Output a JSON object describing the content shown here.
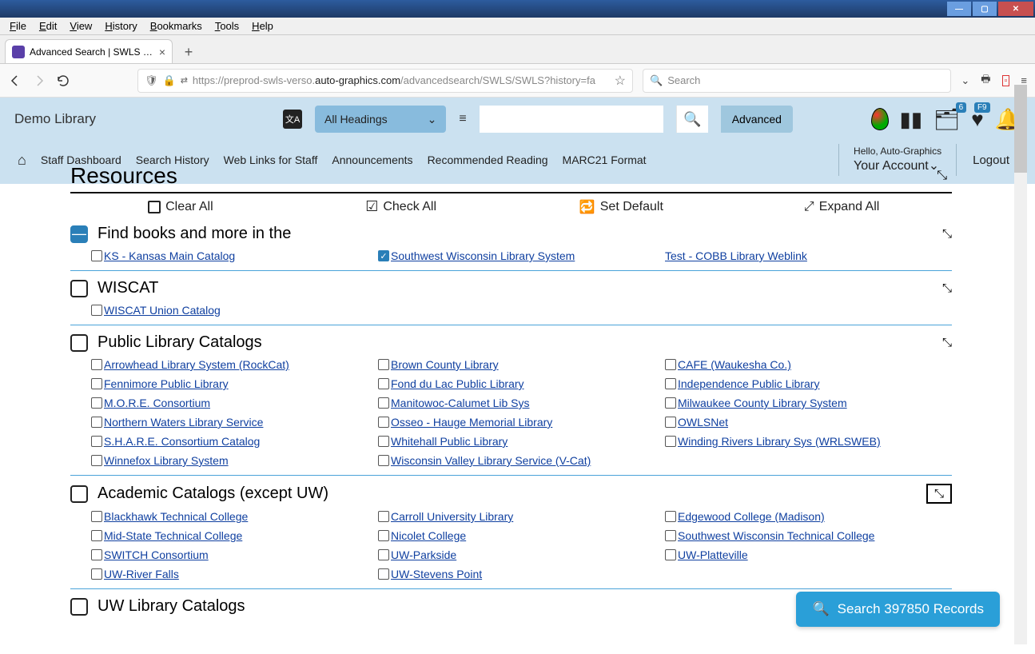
{
  "browser": {
    "menubar": [
      "File",
      "Edit",
      "View",
      "History",
      "Bookmarks",
      "Tools",
      "Help"
    ],
    "tab_title": "Advanced Search | SWLS | SWLS",
    "url_prefix": "https://preprod-swls-verso.",
    "url_domain": "auto-graphics.com",
    "url_suffix": "/advancedsearch/SWLS/SWLS?history=fa",
    "search_placeholder": "Search"
  },
  "header": {
    "brand": "Demo Library",
    "heading_selector": "All Headings",
    "advanced_btn": "Advanced",
    "cart_badge": "6",
    "fav_badge": "F9",
    "nav": [
      "Staff Dashboard",
      "Search History",
      "Web Links for Staff",
      "Announcements",
      "Recommended Reading",
      "MARC21 Format"
    ],
    "hello": "Hello, Auto-Graphics",
    "account": "Your Account",
    "logout": "Logout"
  },
  "page": {
    "resources_title": "Resources",
    "clear_all": "Clear All",
    "check_all": "Check All",
    "set_default": "Set Default",
    "expand_all": "Expand All",
    "fab_label": "Search 397850 Records"
  },
  "groups": [
    {
      "title": "Find books and more in the",
      "indeterminate": true,
      "items": [
        {
          "label": "KS - Kansas Main Catalog",
          "checked": false
        },
        {
          "label": "Southwest Wisconsin Library System",
          "checked": true
        },
        {
          "label": "Test - COBB Library Weblink",
          "checked": false,
          "nocbx": true
        }
      ]
    },
    {
      "title": "WISCAT",
      "items": [
        {
          "label": "WISCAT Union Catalog",
          "checked": false
        }
      ]
    },
    {
      "title": "Public Library Catalogs",
      "items": [
        {
          "label": "Arrowhead Library System (RockCat)"
        },
        {
          "label": "Brown County Library"
        },
        {
          "label": "CAFE (Waukesha Co.)"
        },
        {
          "label": "Fennimore Public Library"
        },
        {
          "label": "Fond du Lac Public Library"
        },
        {
          "label": "Independence Public Library"
        },
        {
          "label": "M.O.R.E. Consortium"
        },
        {
          "label": "Manitowoc-Calumet Lib Sys"
        },
        {
          "label": "Milwaukee County Library System"
        },
        {
          "label": "Northern Waters Library Service"
        },
        {
          "label": "Osseo - Hauge Memorial Library"
        },
        {
          "label": "OWLSNet"
        },
        {
          "label": "S.H.A.R.E. Consortium Catalog"
        },
        {
          "label": "Whitehall Public Library"
        },
        {
          "label": "Winding Rivers Library Sys (WRLSWEB)"
        },
        {
          "label": "Winnefox Library System"
        },
        {
          "label": "Wisconsin Valley Library Service (V-Cat)"
        }
      ]
    },
    {
      "title": "Academic Catalogs (except UW)",
      "boxed_collapse": true,
      "items": [
        {
          "label": "Blackhawk Technical College"
        },
        {
          "label": "Carroll University Library"
        },
        {
          "label": "Edgewood College (Madison)"
        },
        {
          "label": "Mid-State Technical College"
        },
        {
          "label": "Nicolet College"
        },
        {
          "label": "Southwest Wisconsin Technical College"
        },
        {
          "label": "SWITCH Consortium"
        },
        {
          "label": "UW-Parkside"
        },
        {
          "label": "UW-Platteville"
        },
        {
          "label": "UW-River Falls"
        },
        {
          "label": "UW-Stevens Point"
        }
      ]
    },
    {
      "title": "UW Library Catalogs",
      "expand_icon": true,
      "items": []
    }
  ]
}
